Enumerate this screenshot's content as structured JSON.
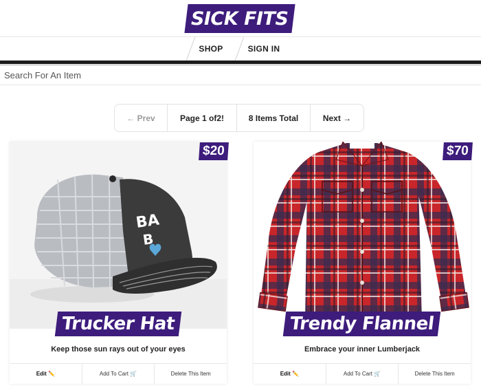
{
  "header": {
    "logo_text": "SICK FITS"
  },
  "nav": {
    "items": [
      {
        "label": "SHOP"
      },
      {
        "label": "SIGN IN"
      }
    ]
  },
  "search": {
    "placeholder": "Search For An Item"
  },
  "pagination": {
    "prev_label": "← Prev",
    "page_label": "Page 1 of2!",
    "total_label": "8 Items Total",
    "next_label": "Next →"
  },
  "products": [
    {
      "price": "$20",
      "title": "Trucker Hat",
      "description": "Keep those sun rays out of your eyes",
      "image_icon": "trucker-hat-image",
      "actions": {
        "edit": "Edit ✏️",
        "add_to_cart": "Add To Cart 🛒",
        "delete": "Delete This Item"
      }
    },
    {
      "price": "$70",
      "title": "Trendy Flannel",
      "description": "Embrace your inner Lumberjack",
      "image_icon": "flannel-shirt-image",
      "actions": {
        "edit": "Edit ✏️",
        "add_to_cart": "Add To Cart 🛒",
        "delete": "Delete This Item"
      }
    }
  ],
  "colors": {
    "brand": "#3d1c7c",
    "text": "#393939",
    "border": "#e6e6e6"
  }
}
